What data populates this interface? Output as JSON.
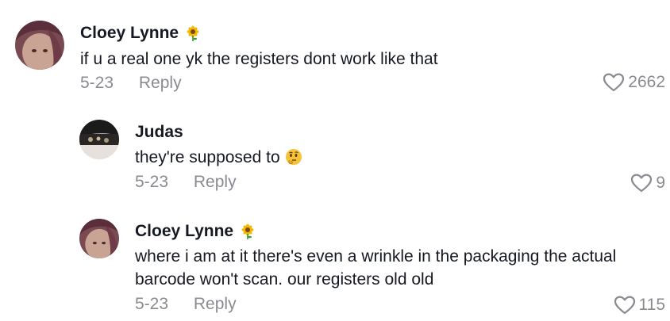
{
  "comments": [
    {
      "author": "Cloey Lynne",
      "text": "if u a real one yk the registers dont work like that",
      "date": "5-23",
      "reply_label": "Reply",
      "likes": "2662"
    },
    {
      "author": "Judas",
      "text": "they're supposed to",
      "date": "5-23",
      "reply_label": "Reply",
      "likes": "9"
    },
    {
      "author": "Cloey Lynne",
      "text": "where i am at it there's even a wrinkle in the packaging the actual barcode won't scan. our registers old old",
      "date": "5-23",
      "reply_label": "Reply",
      "likes": "115"
    }
  ],
  "icons": {
    "author_badge": "sunflower-icon",
    "reply_emoji": "thinking-face-emoji",
    "like": "heart-outline-icon"
  },
  "colors": {
    "text": "#161823",
    "muted": "#8a8b91",
    "background": "#ffffff"
  }
}
